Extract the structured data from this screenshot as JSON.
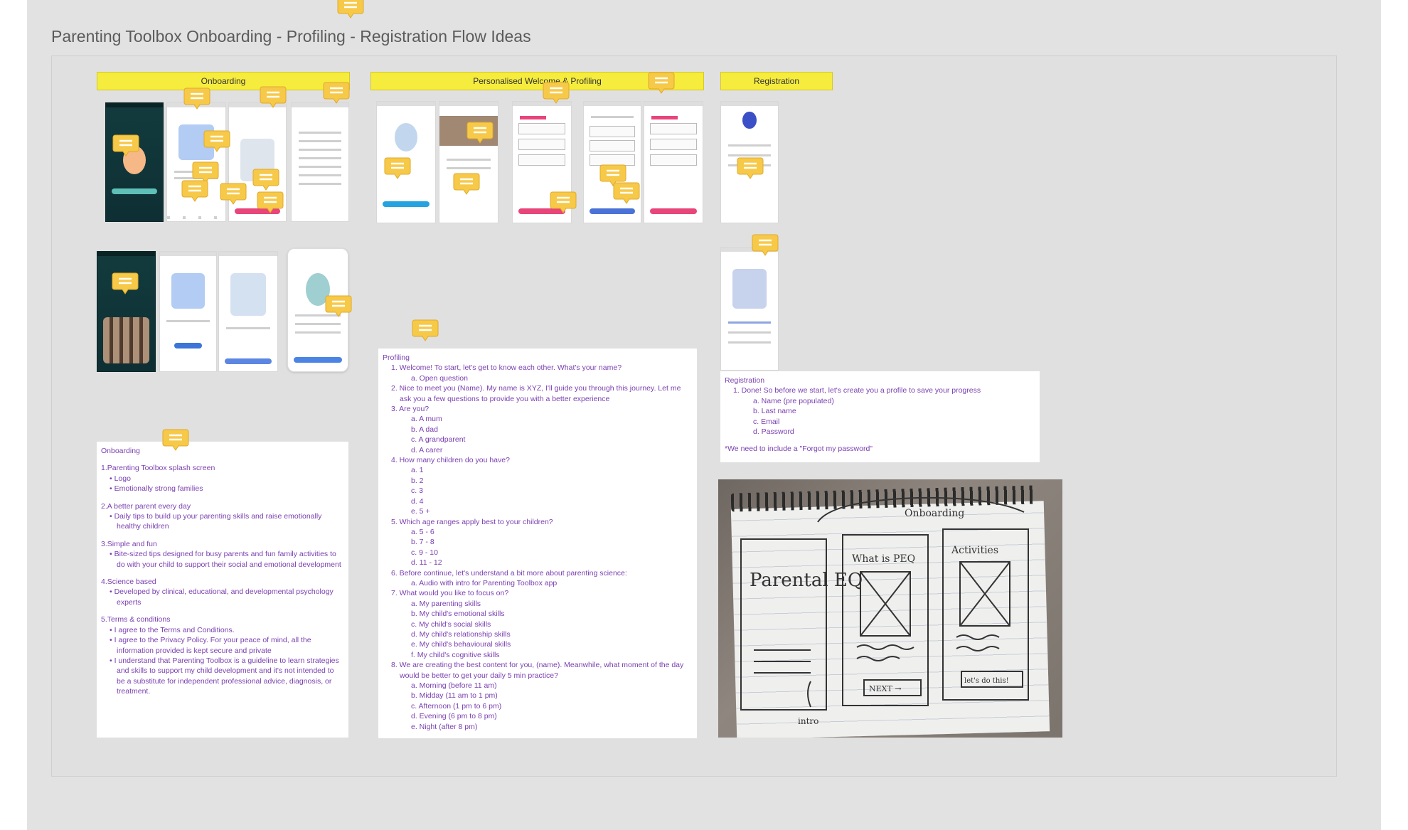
{
  "board": {
    "title": "Parenting Toolbox Onboarding - Profiling - Registration Flow Ideas"
  },
  "sections": {
    "onboarding_label": "Onboarding",
    "profiling_label": "Personalised Welcome & Profiling",
    "registration_label": "Registration"
  },
  "colors": {
    "sticky_label": "#f6ec3e",
    "comment": "#f7c948",
    "note_text": "#7a3fb0",
    "canvas": "#e2e2e2"
  },
  "icons": {
    "comment": "comment-bubble-icon"
  },
  "notes": {
    "onboarding": {
      "title": "Onboarding",
      "s1_title": "1.Parenting Toolbox splash screen",
      "s1_b1": "Logo",
      "s1_b2": "Emotionally strong families",
      "s2_title": "2.A better parent every day",
      "s2_b1": "Daily tips to build up your parenting skills and raise emotionally healthy children",
      "s3_title": "3.Simple and fun",
      "s3_b1": "Bite-sized tips designed for busy parents and fun family activities to do with your child to support their social and emotional development",
      "s4_title": "4.Science based",
      "s4_b1": "Developed by clinical, educational, and developmental psychology experts",
      "s5_title": "5.Terms & conditions",
      "s5_b1": "I agree to the Terms and Conditions.",
      "s5_b2": "I agree to the Privacy Policy. For your peace of mind, all the information provided is kept secure and private",
      "s5_b3": "I understand that Parenting Toolbox is a guideline to learn strategies and skills to support my child development and it's not intended to be a substitute for independent professional advice, diagnosis, or treatment."
    },
    "profiling": {
      "title": "Profiling",
      "q1": "1. Welcome! To start, let's get to know each other. What's your name?",
      "q1a": "a. Open question",
      "q2": "2. Nice to meet you (Name). My name is XYZ, I'll guide you through this journey. Let me ask you a few questions to provide you with a better experience",
      "q3": "3. Are you?",
      "q3a": "a. A mum",
      "q3b": "b. A dad",
      "q3c": "c. A grandparent",
      "q3d": "d. A carer",
      "q4": "4. How many children do you have?",
      "q4a": "a. 1",
      "q4b": "b. 2",
      "q4c": "c. 3",
      "q4d": "d. 4",
      "q4e": "e. 5 +",
      "q5": "5. Which age ranges apply best to your children?",
      "q5a": "a. 5 - 6",
      "q5b": "b. 7 - 8",
      "q5c": "c. 9 - 10",
      "q5d": "d. 11 - 12",
      "q6": "6. Before continue, let's understand a bit more about parenting science:",
      "q6a": "a. Audio with intro for Parenting Toolbox app",
      "q7": "7. What would you like to focus on?",
      "q7a": "a. My parenting skills",
      "q7b": "b. My child's emotional skills",
      "q7c": "c. My child's social skills",
      "q7d": "d. My child's relationship skills",
      "q7e": "e. My child's behavioural skills",
      "q7f": "f. My child's cognitive skills",
      "q8": "8. We are creating the best content for you, (name). Meanwhile, what moment of the day would be better to get your daily 5 min practice?",
      "q8a": "a. Morning (before 11 am)",
      "q8b": "b. Midday (11 am to 1 pm)",
      "q8c": "c. Afternoon (1 pm to 6 pm)",
      "q8d": "d. Evening (6 pm to 8 pm)",
      "q8e": "e. Night (after 8 pm)"
    },
    "registration": {
      "title": "Registration",
      "item1": "1. Done! So before we start, let's create you a profile to save your progress",
      "a": "a. Name (pre populated)",
      "b": "b. Last name",
      "c": "c. Email",
      "d": "d. Password",
      "footnote": "*We need to include a \"Forgot my password\""
    }
  },
  "sketch": {
    "label_top": "Onboarding",
    "screen1": "Parental EQ",
    "screen2": "What is PEQ",
    "screen3": "Activities",
    "btn_next": "NEXT →",
    "btn_go": "let's do this!",
    "intro": "intro"
  }
}
